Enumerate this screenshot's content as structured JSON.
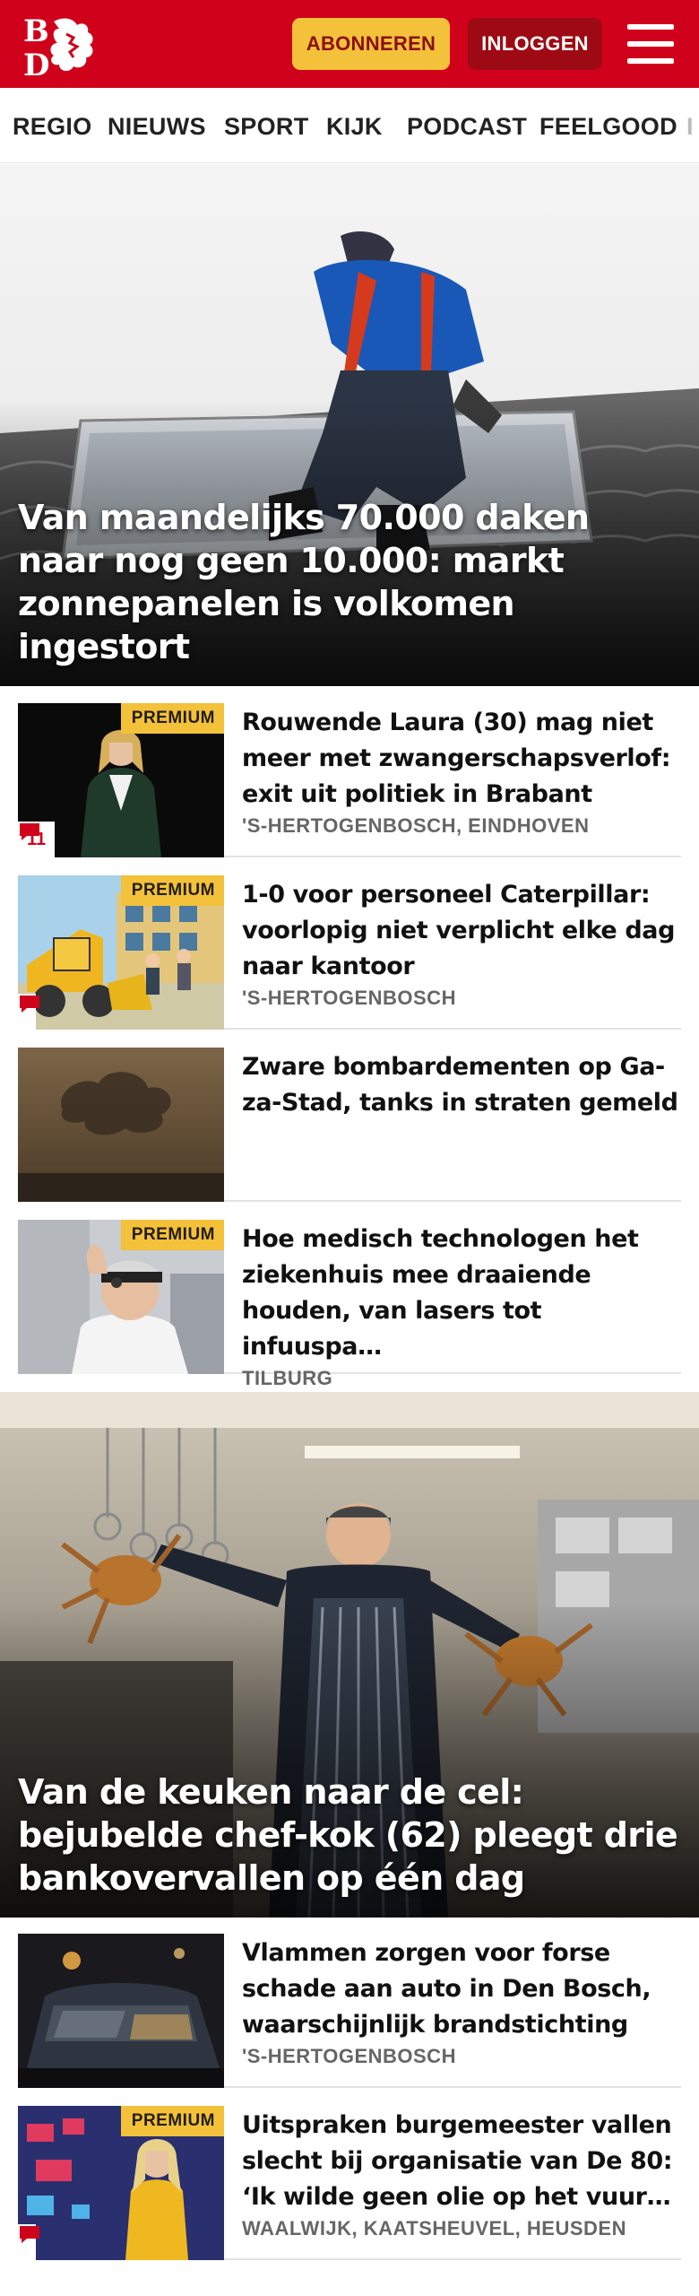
{
  "brand": {
    "logo_text_top": "B",
    "logo_text_bottom": "D",
    "accent": "#d0021b",
    "premium_color": "#f3c13a"
  },
  "header": {
    "subscribe_label": "ABONNEREN",
    "login_label": "INLOGGEN",
    "menu_icon": "hamburger-icon"
  },
  "nav": {
    "items": [
      "REGIO",
      "NIEUWS",
      "SPORT",
      "KIJK",
      "PODCAST",
      "FEELGOOD"
    ]
  },
  "hero1": {
    "title": "Van maandelijks 70.000 daken naar nog geen 10.000: markt zonnepanelen is volkomen ingestort"
  },
  "articles": [
    {
      "title": "Rouwende Laura (30) mag niet meer met zwangerschapsverlof: exit uit politiek in Brabant",
      "location": "'S-HERTOGENBOSCH, EINDHOVEN",
      "premium": "PREMIUM",
      "comments": "11"
    },
    {
      "title": "1-0 voor personeel Caterpillar: voorlopig niet verplicht elke dag naar kantoor",
      "location": "'S-HERTOGENBOSCH",
      "premium": "PREMIUM"
    },
    {
      "title": "Zware bombardementen op Ga­za-Stad, tanks in straten gemeld"
    },
    {
      "title": "Hoe medisch technologen het ziekenhuis mee draaiende houden, van lasers tot infuuspa…",
      "location": "TILBURG",
      "premium": "PREMIUM"
    },
    {
      "title": "Vlammen zorgen voor forse schade aan auto in Den Bosch, waarschijnlijk brandstichting",
      "location": "'S-HERTOGENBOSCH"
    },
    {
      "title": "Uitspraken burgemeester vallen slecht bij organisatie van De 80: ‘Ik wilde geen olie op het vuur…",
      "location": "WAALWIJK, KAATSHEUVEL, HEUSDEN",
      "premium": "PREMIUM"
    }
  ],
  "hero2": {
    "title": "Van de keuken naar de cel: bejubelde chef-kok (62) pleegt drie bankoverval­len op één dag"
  }
}
